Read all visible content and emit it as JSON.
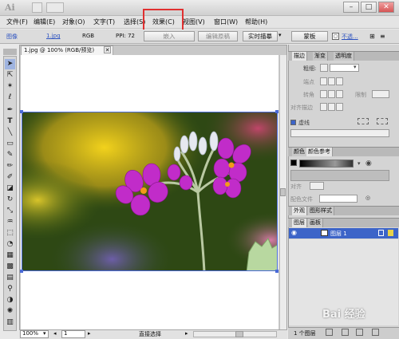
{
  "app": {
    "logo": "Ai"
  },
  "menu": {
    "items": [
      "文件(F)",
      "编辑(E)",
      "对象(O)",
      "文字(T)",
      "选择(S)",
      "效果(C)",
      "视图(V)",
      "窗口(W)",
      "帮助(H)"
    ],
    "highlighted": "效果(C)"
  },
  "control_bar": {
    "type_label": "图像",
    "file_link": "1.jpg",
    "color_mode": "RGB",
    "ppi": "PPI: 72",
    "embed_button": "嵌入",
    "edit_original_button": "编辑原稿",
    "live_trace_button": "实时描摹",
    "mask_button": "蒙板",
    "opacity_label": "不透..."
  },
  "document": {
    "tab_title": "1.jpg @ 100% (RGB/预览)",
    "zoom": "100%",
    "artboard_num": "1",
    "status_text": "直接选择"
  },
  "stroke_panel": {
    "tabs": [
      "描边",
      "渐变",
      "透明度"
    ],
    "weight_label": "粗细:",
    "cap_label": "端点",
    "corner_label": "转角",
    "limit_label": "限制",
    "align_label": "对齐描边",
    "dashed_label": "虚线"
  },
  "color_panel": {
    "tabs": [
      "颜色",
      "颜色参考"
    ]
  },
  "align_panel": {
    "align_label": "对齐",
    "color_group_label": "配色文件"
  },
  "appearance_panel": {
    "tabs": [
      "外观",
      "图形样式"
    ]
  },
  "layers_panel": {
    "tabs": [
      "图层",
      "画板"
    ],
    "layer_name": "图层 1",
    "layer_count": "1 个图层"
  },
  "watermark": "Bai 经验"
}
